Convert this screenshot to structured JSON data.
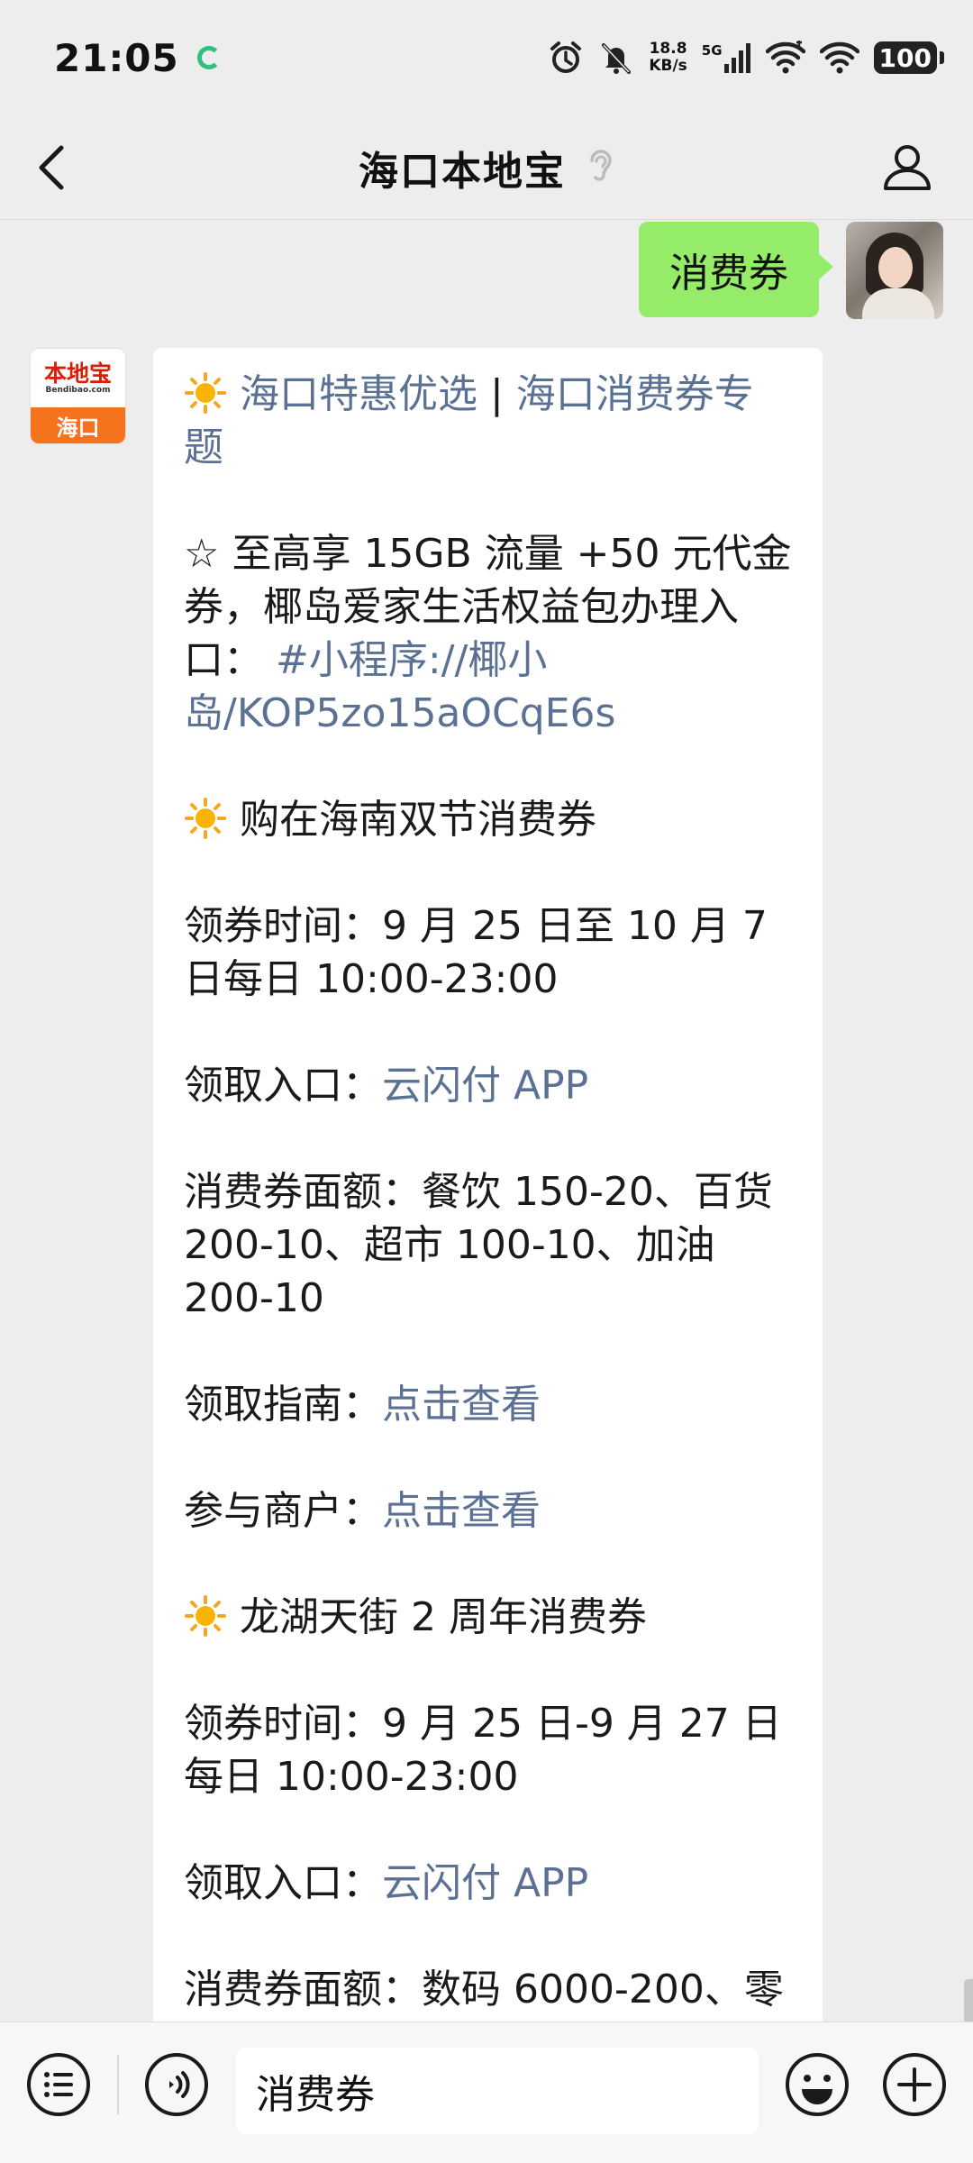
{
  "status_bar": {
    "time": "21:05",
    "net_speed_value": "18.8",
    "net_speed_unit": "KB/s",
    "network_type": "5G",
    "battery": "100"
  },
  "header": {
    "title": "海口本地宝"
  },
  "chat": {
    "sent_message": "消费券",
    "bot_avatar": {
      "logo_text": "本地宝",
      "logo_sub": "Bendibao.com",
      "city": "海口"
    },
    "message": {
      "title_link1": "海口特惠优选",
      "title_sep": " | ",
      "title_link2": "海口消费券专题",
      "promo_star": "☆",
      "promo_text": "至高享 15GB 流量 +50 元代金券，椰岛爱家生活权益包办理入口：",
      "promo_link": "#小程序://椰小岛/KOP5zo15aOCqE6s",
      "section1_title": "购在海南双节消费券",
      "section1_time_label": "领券时间：",
      "section1_time": "9 月 25 日至 10 月 7 日每日 10:00-23:00",
      "section1_entry_label": "领取入口：",
      "section1_entry": "云闪付 APP",
      "section1_value_label": "消费券面额：",
      "section1_value": "餐饮 150-20、百货 200-10、超市 100-10、加油 200-10",
      "section1_guide_label": "领取指南：",
      "section1_guide": "点击查看",
      "section1_merchant_label": "参与商户：",
      "section1_merchant": "点击查看",
      "section2_title": "龙湖天街 2 周年消费券",
      "section2_time_label": "领券时间：",
      "section2_time": "9 月 25 日-9 月 27 日每日 10:00-23:00",
      "section2_entry_label": "领取入口：",
      "section2_entry": "云闪付 APP",
      "section2_value_label": "消费券面额：",
      "section2_value": "数码 6000-200、零"
    }
  },
  "input_bar": {
    "text": "消费券"
  },
  "colors": {
    "link": "#5b7194",
    "sent_bubble": "#95ec69",
    "background": "#ededed"
  },
  "icons": {
    "back": "chevron-left-icon",
    "profile": "person-icon",
    "voice_mode": "ear-icon",
    "menu": "list-icon",
    "voice": "voice-icon",
    "emoji": "smiley-icon",
    "more": "plus-circle-icon"
  }
}
